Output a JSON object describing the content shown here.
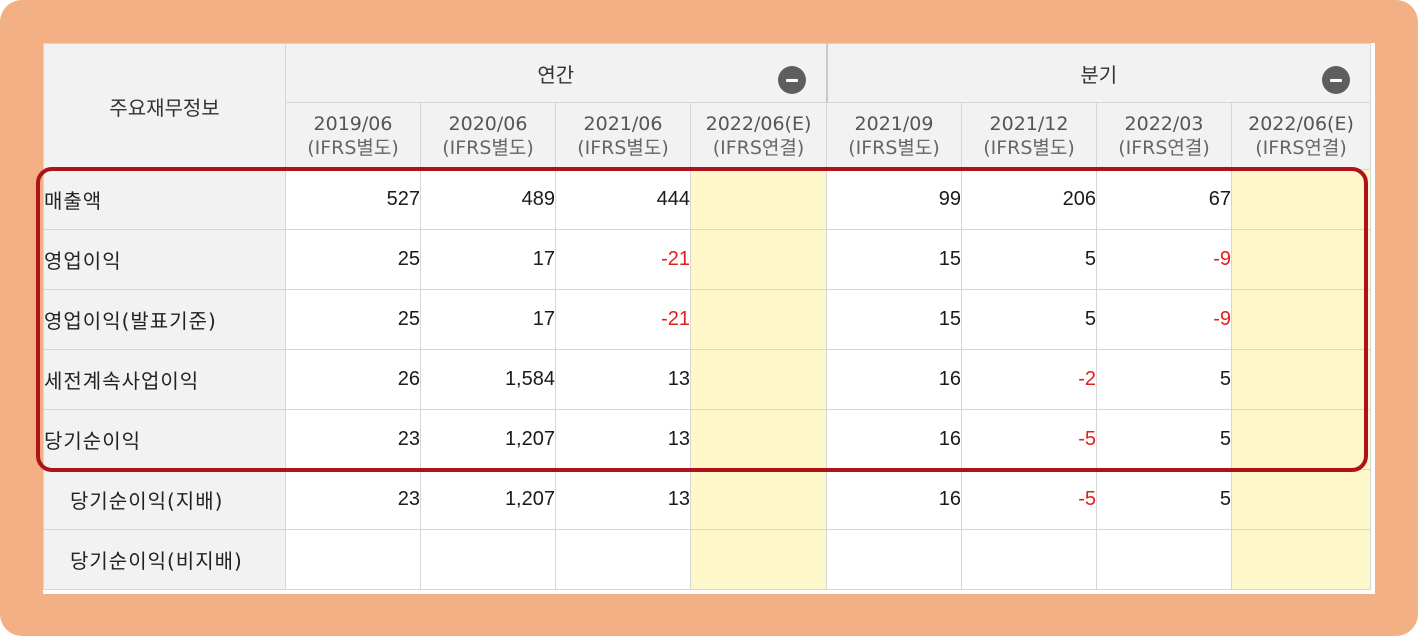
{
  "table": {
    "title": "주요재무정보",
    "groups": [
      {
        "label": "연간",
        "collapse_icon": "minus-circle-icon"
      },
      {
        "label": "분기",
        "collapse_icon": "minus-circle-icon"
      }
    ],
    "periods": [
      {
        "date": "2019/06",
        "basis": "(IFRS별도)"
      },
      {
        "date": "2020/06",
        "basis": "(IFRS별도)"
      },
      {
        "date": "2021/06",
        "basis": "(IFRS별도)"
      },
      {
        "date": "2022/06(E)",
        "basis": "(IFRS연결)"
      },
      {
        "date": "2021/09",
        "basis": "(IFRS별도)"
      },
      {
        "date": "2021/12",
        "basis": "(IFRS별도)"
      },
      {
        "date": "2022/03",
        "basis": "(IFRS연결)"
      },
      {
        "date": "2022/06(E)",
        "basis": "(IFRS연결)"
      }
    ],
    "rows": [
      {
        "label": "매출액",
        "values": [
          "527",
          "489",
          "444",
          "",
          "99",
          "206",
          "67",
          ""
        ]
      },
      {
        "label": "영업이익",
        "values": [
          "25",
          "17",
          "-21",
          "",
          "15",
          "5",
          "-9",
          ""
        ]
      },
      {
        "label": "영업이익(발표기준)",
        "values": [
          "25",
          "17",
          "-21",
          "",
          "15",
          "5",
          "-9",
          ""
        ]
      },
      {
        "label": "세전계속사업이익",
        "values": [
          "26",
          "1,584",
          "13",
          "",
          "16",
          "-2",
          "5",
          ""
        ]
      },
      {
        "label": "당기순이익",
        "values": [
          "23",
          "1,207",
          "13",
          "",
          "16",
          "-5",
          "5",
          ""
        ]
      },
      {
        "label": "당기순이익(지배)",
        "values": [
          "23",
          "1,207",
          "13",
          "",
          "16",
          "-5",
          "5",
          ""
        ]
      },
      {
        "label": "당기순이익(비지배)",
        "values": [
          "",
          "",
          "",
          "",
          "",
          "",
          "",
          ""
        ]
      }
    ]
  },
  "colors": {
    "frame": "#f2b084",
    "highlight": "#b0121a",
    "estimate_fill": "#fdf7c9",
    "negative": "#e0201a",
    "header_bg": "#f2f2f2"
  }
}
